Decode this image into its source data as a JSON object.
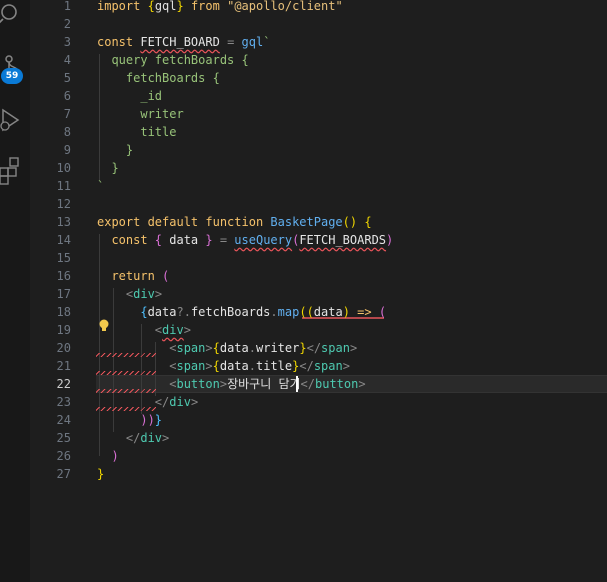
{
  "activity_bar": {
    "scm_badge": "59",
    "icons": [
      "search-icon",
      "source-control-icon",
      "run-debug-icon",
      "extensions-icon"
    ]
  },
  "editor": {
    "active_line": "22",
    "line_numbers": [
      "1",
      "2",
      "3",
      "4",
      "5",
      "6",
      "7",
      "8",
      "9",
      "10",
      "11",
      "12",
      "13",
      "14",
      "15",
      "16",
      "17",
      "18",
      "19",
      "20",
      "21",
      "22",
      "23",
      "24",
      "25",
      "26",
      "27"
    ],
    "lines": [
      [
        {
          "t": "import ",
          "c": "kw"
        },
        {
          "t": "{",
          "c": "br1"
        },
        {
          "t": "gql",
          "c": "plain"
        },
        {
          "t": "}",
          "c": "br1"
        },
        {
          "t": " from ",
          "c": "kw"
        },
        {
          "t": "\"@apollo/client\"",
          "c": "str2"
        }
      ],
      [],
      [
        {
          "t": "const ",
          "c": "kw"
        },
        {
          "t": "FETCH_BOARD",
          "c": "var warn"
        },
        {
          "t": " = ",
          "c": "brk"
        },
        {
          "t": "gql",
          "c": "fn"
        },
        {
          "t": "`",
          "c": "gql"
        }
      ],
      [
        {
          "t": "  query fetchBoards {",
          "c": "gql"
        }
      ],
      [
        {
          "t": "    fetchBoards {",
          "c": "gql"
        }
      ],
      [
        {
          "t": "      _id",
          "c": "gql"
        }
      ],
      [
        {
          "t": "      writer",
          "c": "gql"
        }
      ],
      [
        {
          "t": "      title",
          "c": "gql"
        }
      ],
      [
        {
          "t": "    }",
          "c": "gql"
        }
      ],
      [
        {
          "t": "  }",
          "c": "gql"
        }
      ],
      [
        {
          "t": "`",
          "c": "gql"
        }
      ],
      [],
      [
        {
          "t": "export default function ",
          "c": "kw"
        },
        {
          "t": "BasketPage",
          "c": "fn"
        },
        {
          "t": "() ",
          "c": "br1"
        },
        {
          "t": "{",
          "c": "br1"
        }
      ],
      [
        {
          "t": "  const ",
          "c": "kw"
        },
        {
          "t": "{ ",
          "c": "br2"
        },
        {
          "t": "data",
          "c": "var"
        },
        {
          "t": " } ",
          "c": "br2"
        },
        {
          "t": "= ",
          "c": "brk"
        },
        {
          "t": "useQuery",
          "c": "fn warn"
        },
        {
          "t": "(",
          "c": "br2"
        },
        {
          "t": "FETCH_BOARDS",
          "c": "var warn"
        },
        {
          "t": ")",
          "c": "br2"
        }
      ],
      [],
      [
        {
          "t": "  return ",
          "c": "kw"
        },
        {
          "t": "(",
          "c": "br2"
        }
      ],
      [
        {
          "t": "    <",
          "c": "brk"
        },
        {
          "t": "div",
          "c": "tag"
        },
        {
          "t": ">",
          "c": "brk"
        }
      ],
      [
        {
          "t": "      {",
          "c": "br3"
        },
        {
          "t": "data",
          "c": "var"
        },
        {
          "t": "?.",
          "c": "brk"
        },
        {
          "t": "fetchBoards",
          "c": "var"
        },
        {
          "t": ".",
          "c": "brk"
        },
        {
          "t": "map",
          "c": "fn"
        },
        {
          "t": "((",
          "c": "br1"
        },
        {
          "t": "data",
          "c": "var"
        },
        {
          "t": ") ",
          "c": "br1"
        },
        {
          "t": "=> ",
          "c": "kw"
        },
        {
          "t": "(",
          "c": "br2"
        }
      ],
      [
        {
          "t": "        <",
          "c": "brk"
        },
        {
          "t": "div",
          "c": "tag warn"
        },
        {
          "t": ">",
          "c": "brk"
        }
      ],
      [
        {
          "t": "          <",
          "c": "brk"
        },
        {
          "t": "span",
          "c": "tag"
        },
        {
          "t": ">",
          "c": "brk"
        },
        {
          "t": "{",
          "c": "br1"
        },
        {
          "t": "data",
          "c": "var"
        },
        {
          "t": ".",
          "c": "brk"
        },
        {
          "t": "writer",
          "c": "var"
        },
        {
          "t": "}",
          "c": "br1"
        },
        {
          "t": "</",
          "c": "brk"
        },
        {
          "t": "span",
          "c": "tag"
        },
        {
          "t": ">",
          "c": "brk"
        }
      ],
      [
        {
          "t": "          <",
          "c": "brk"
        },
        {
          "t": "span",
          "c": "tag"
        },
        {
          "t": ">",
          "c": "brk"
        },
        {
          "t": "{",
          "c": "br1"
        },
        {
          "t": "data",
          "c": "var"
        },
        {
          "t": ".",
          "c": "brk"
        },
        {
          "t": "title",
          "c": "var"
        },
        {
          "t": "}",
          "c": "br1"
        },
        {
          "t": "</",
          "c": "brk"
        },
        {
          "t": "span",
          "c": "tag"
        },
        {
          "t": ">",
          "c": "brk"
        }
      ],
      [
        {
          "t": "          <",
          "c": "brk"
        },
        {
          "t": "button",
          "c": "tag"
        },
        {
          "t": ">",
          "c": "brk"
        },
        {
          "t": "장바구니 담기",
          "c": "plain"
        },
        {
          "t": "</",
          "c": "brk"
        },
        {
          "t": "button",
          "c": "tag"
        },
        {
          "t": ">",
          "c": "brk"
        }
      ],
      [
        {
          "t": "        </",
          "c": "brk"
        },
        {
          "t": "div",
          "c": "tag"
        },
        {
          "t": ">",
          "c": "brk"
        }
      ],
      [
        {
          "t": "      ))",
          "c": "br2"
        },
        {
          "t": "}",
          "c": "br3"
        }
      ],
      [
        {
          "t": "    </",
          "c": "brk"
        },
        {
          "t": "div",
          "c": "tag"
        },
        {
          "t": ">",
          "c": "brk"
        }
      ],
      [
        {
          "t": "  )",
          "c": "br2"
        }
      ],
      [
        {
          "t": "}",
          "c": "br1"
        }
      ]
    ]
  }
}
